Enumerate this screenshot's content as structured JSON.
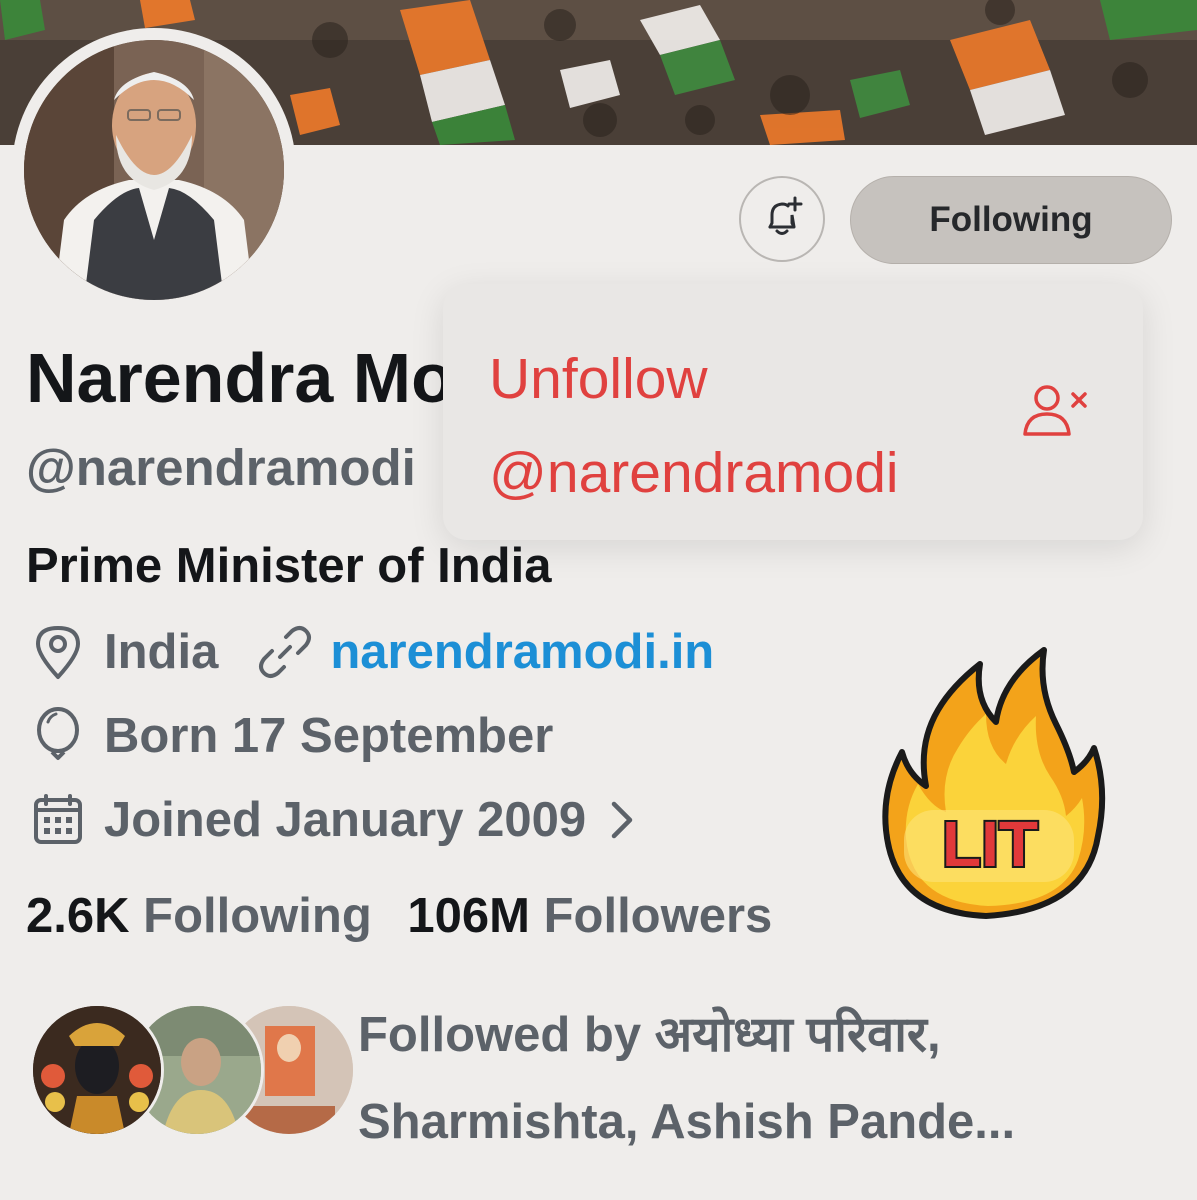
{
  "profile": {
    "display_name": "Narendra Modi",
    "handle": "@narendramodi",
    "bio": "Prime Minister of India",
    "location": "India",
    "website": "narendramodi.in",
    "birthday": "Born 17 September",
    "joined": "Joined January 2009"
  },
  "actions": {
    "following_label": "Following",
    "notify_icon": "bell-plus-icon"
  },
  "popup_menu": {
    "unfollow_line1": "Unfollow",
    "unfollow_line2": "@narendramodi",
    "icon": "person-remove-icon"
  },
  "stats": {
    "following_count": "2.6K",
    "following_label": "Following",
    "followers_count": "106M",
    "followers_label": "Followers"
  },
  "followed_by": {
    "line1": "Followed by अयोध्या परिवार,",
    "line2": "Sharmishta, Ashish Pande..."
  },
  "sticker": {
    "text": "LIT"
  },
  "colors": {
    "accent_link": "#1c8fd6",
    "danger": "#e0413f",
    "background": "#efedeb"
  }
}
